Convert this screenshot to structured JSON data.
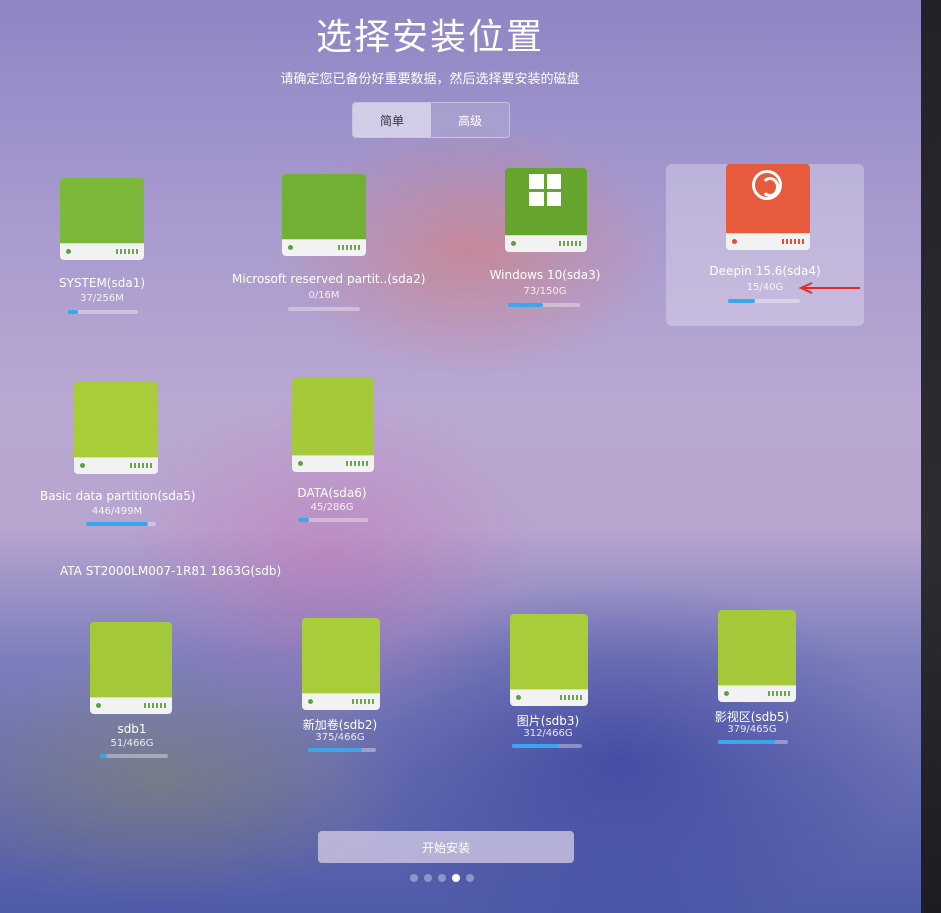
{
  "header": {
    "title": "选择安装位置",
    "subtitle": "请确定您已备份好重要数据，然后选择要安装的磁盘"
  },
  "mode_tabs": [
    {
      "label": "简单",
      "active": true
    },
    {
      "label": "高级",
      "active": false
    }
  ],
  "sda_partitions": [
    {
      "name": "SYSTEM(sda1)",
      "usage": "37/256M",
      "used_fraction": 0.14,
      "icon": "hard-drive-icon"
    },
    {
      "name": "Microsoft reserved partit..(sda2)",
      "usage": "0/16M",
      "used_fraction": 0.0,
      "icon": "hard-drive-icon"
    },
    {
      "name": "Windows 10(sda3)",
      "usage": "73/150G",
      "used_fraction": 0.49,
      "icon": "windows-logo-icon"
    },
    {
      "name": "Deepin 15.6(sda4)",
      "usage": "15/40G",
      "used_fraction": 0.38,
      "icon": "deepin-logo-icon",
      "selected": true
    },
    {
      "name": "Basic data partition(sda5)",
      "usage": "446/499M",
      "used_fraction": 0.89,
      "icon": "hard-drive-icon"
    },
    {
      "name": "DATA(sda6)",
      "usage": "45/286G",
      "used_fraction": 0.16,
      "icon": "hard-drive-icon"
    }
  ],
  "sdb_device": {
    "label": "ATA ST2000LM007-1R81 1863G(sdb)"
  },
  "sdb_partitions": [
    {
      "name": "sdb1",
      "usage": "51/466G",
      "used_fraction": 0.11,
      "icon": "hard-drive-icon"
    },
    {
      "name": "新加卷(sdb2)",
      "usage": "375/466G",
      "used_fraction": 0.8,
      "icon": "hard-drive-icon"
    },
    {
      "name": "图片(sdb3)",
      "usage": "312/466G",
      "used_fraction": 0.67,
      "icon": "hard-drive-icon"
    },
    {
      "name": "影视区(sdb5)",
      "usage": "379/465G",
      "used_fraction": 0.82,
      "icon": "hard-drive-icon"
    }
  ],
  "install_button": {
    "label": "开始安装"
  },
  "pager": {
    "page_count": 5,
    "active_index": 3
  },
  "colors": {
    "drive_green": "#7cb83a",
    "drive_yellow_green": "#a9cc3a",
    "drive_orange": "#e85a3c",
    "usage_fill": "#3aa7ec",
    "arrow_red": "#e52a2a"
  }
}
